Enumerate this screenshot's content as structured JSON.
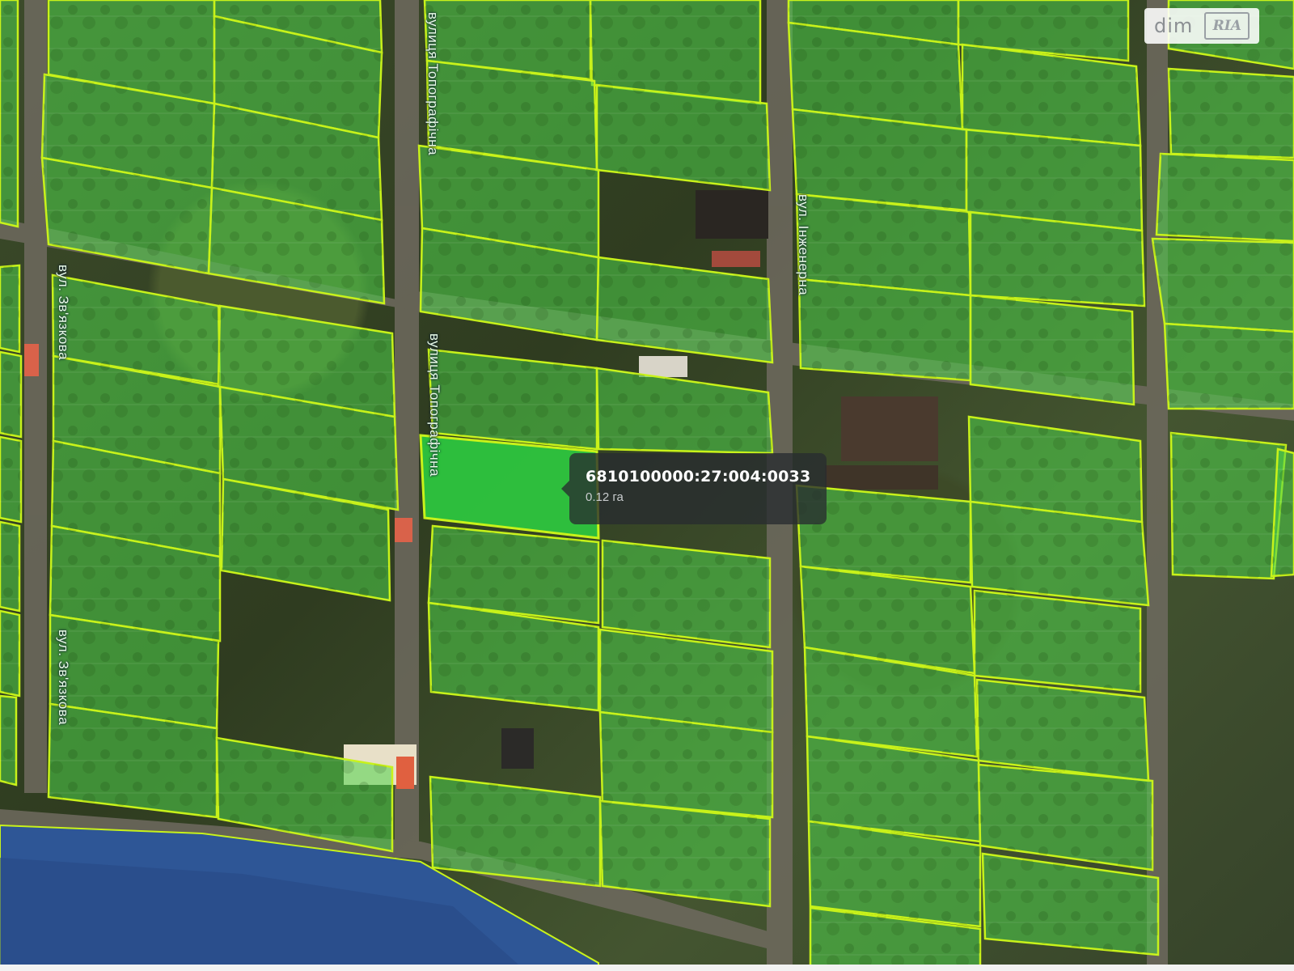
{
  "map": {
    "parcel_fill_color": "#4fd44a",
    "parcel_border_color": "#c8f21a",
    "selected_fill_color": "#2ecc40",
    "water_color": "#2f5a9c",
    "streets": [
      {
        "id": "topohrafichna-top",
        "label": "вулиця Топографічна"
      },
      {
        "id": "topohrafichna-mid",
        "label": "вулиця Топографічна"
      },
      {
        "id": "zviazkova-top",
        "label": "вул. Зв'язкова"
      },
      {
        "id": "zviazkova-bottom",
        "label": "вул. Зв'язкова"
      },
      {
        "id": "inzhenerna",
        "label": "вул. Інженерна"
      }
    ]
  },
  "tooltip": {
    "cadastral_number": "6810100000:27:004:0033",
    "area": "0.12 га"
  },
  "logo": {
    "dim": "dim",
    "ria": "RIA"
  },
  "icons": {
    "logo": "dimria-logo-icon"
  }
}
